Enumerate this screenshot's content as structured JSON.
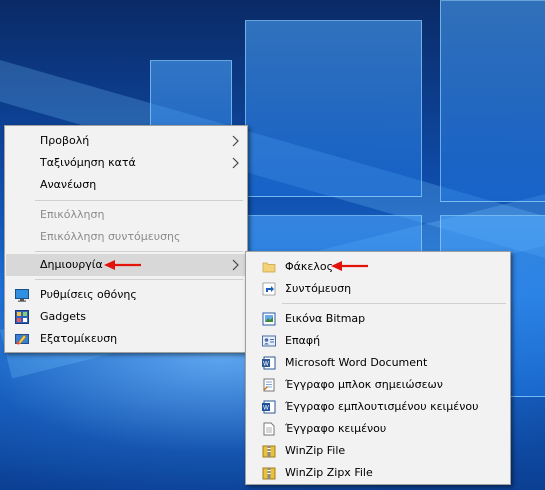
{
  "context_menu": {
    "items": [
      {
        "label": "Προβολή"
      },
      {
        "label": "Ταξινόμηση κατά"
      },
      {
        "label": "Ανανέωση"
      },
      {
        "label": "Επικόλληση"
      },
      {
        "label": "Επικόλληση συντόμευσης"
      },
      {
        "label": "Δημιουργία"
      },
      {
        "label": "Ρυθμίσεις οθόνης"
      },
      {
        "label": "Gadgets"
      },
      {
        "label": "Εξατομίκευση"
      }
    ]
  },
  "new_submenu": {
    "items": [
      {
        "label": "Φάκελος"
      },
      {
        "label": "Συντόμευση"
      },
      {
        "label": "Εικόνα Bitmap"
      },
      {
        "label": "Επαφή"
      },
      {
        "label": "Microsoft Word Document"
      },
      {
        "label": "Έγγραφο μπλοκ σημειώσεων"
      },
      {
        "label": "Έγγραφο εμπλουτισμένου κειμένου"
      },
      {
        "label": "Έγγραφο κειμένου"
      },
      {
        "label": "WinZip File"
      },
      {
        "label": "WinZip Zipx File"
      }
    ]
  },
  "colors": {
    "menu_bg": "#f2f2f2",
    "highlight": "#d8d8d8",
    "annotation_arrow": "#e3120b"
  }
}
